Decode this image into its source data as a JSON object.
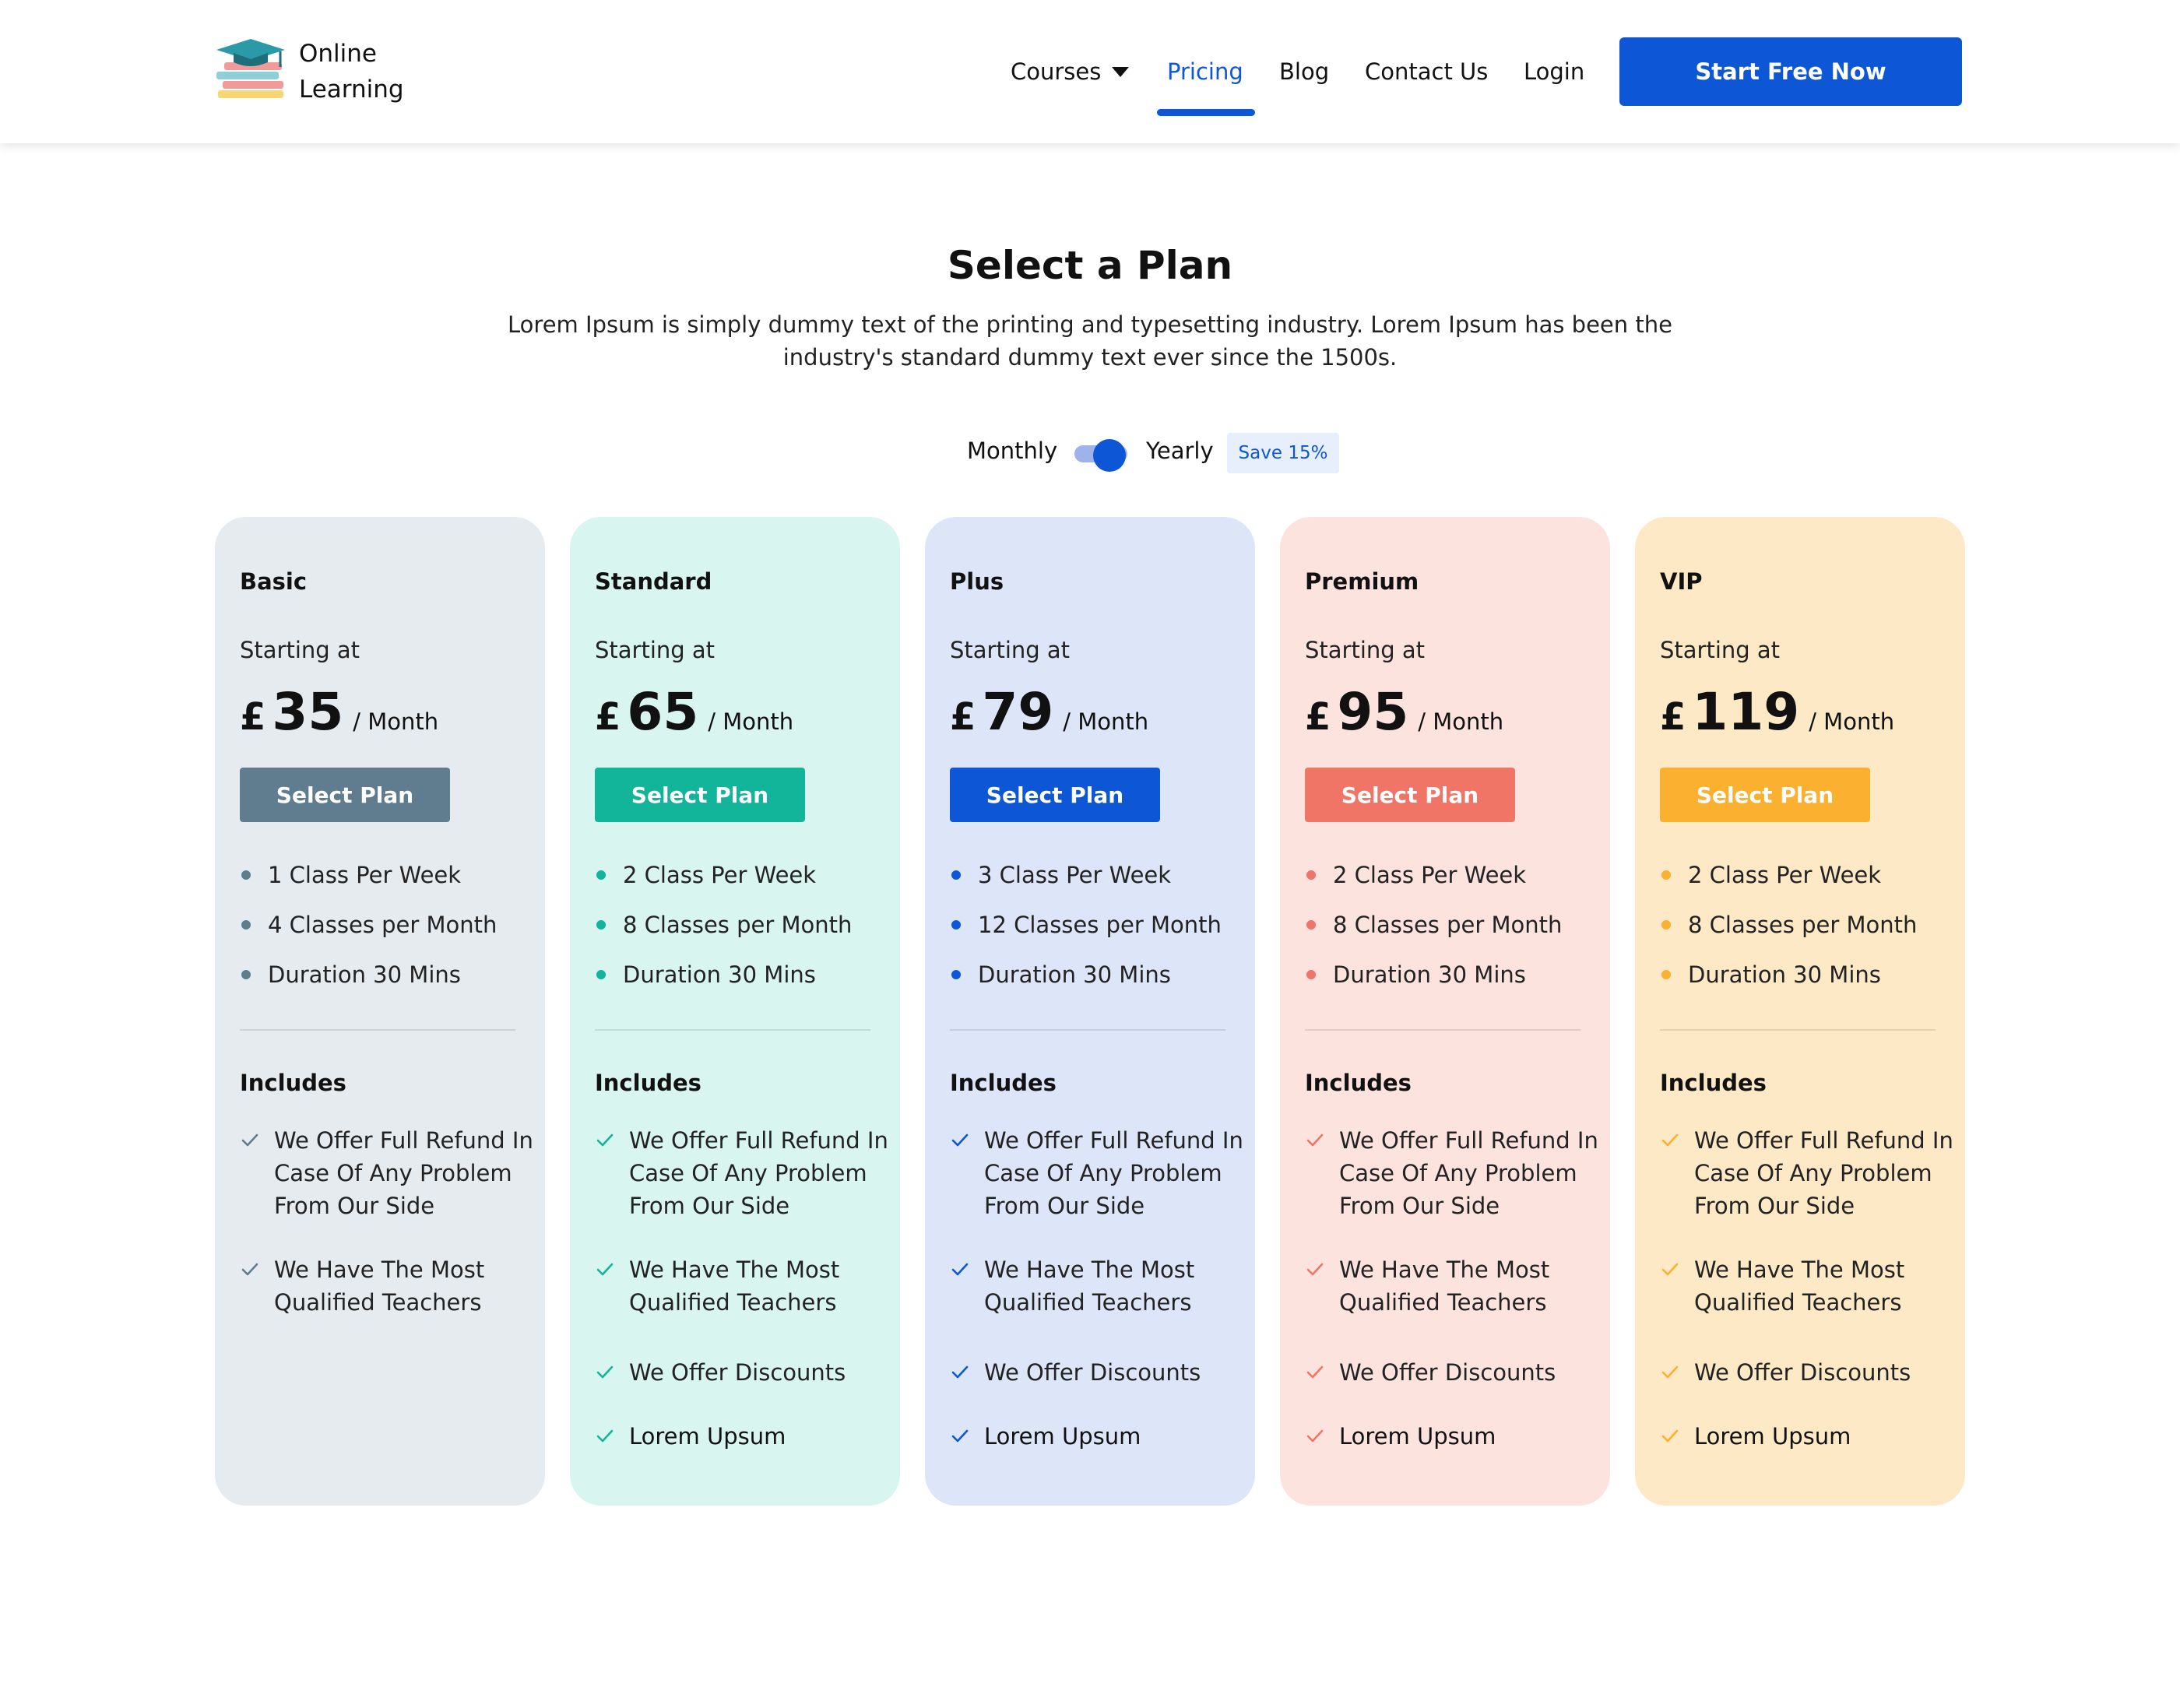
{
  "brand": {
    "line1": "Online",
    "line2": "Learning"
  },
  "nav": {
    "courses": "Courses",
    "pricing": "Pricing",
    "blog": "Blog",
    "contact": "Contact Us",
    "login": "Login",
    "cta": "Start Free Now"
  },
  "hero": {
    "title": "Select a Plan",
    "subtitle": "Lorem Ipsum is simply dummy text of the printing and typesetting industry. Lorem Ipsum has been the industry's standard dummy text ever since the 1500s."
  },
  "billing": {
    "monthly": "Monthly",
    "yearly": "Yearly",
    "selected": "Yearly",
    "save_badge": "Save 15%"
  },
  "colors": {
    "primary": "#0d57d6",
    "basic": "#5f7d8e",
    "standard": "#13b59a",
    "plus": "#0d57d6",
    "premium": "#f17566",
    "vip": "#fbb02f"
  },
  "plans": [
    {
      "name": "Basic",
      "starting": "Starting at",
      "currency": "£",
      "price": "35",
      "period": "/ Month",
      "button": "Select Plan",
      "features": [
        "1 Class Per Week",
        "4 Classes per Month",
        "Duration 30 Mins"
      ],
      "includes_title": "Includes",
      "includes": [
        "We Offer Full Refund In Case Of Any Problem From Our Side",
        "We Have The Most Qualified Teachers"
      ]
    },
    {
      "name": "Standard",
      "starting": "Starting at",
      "currency": "£",
      "price": "65",
      "period": "/ Month",
      "button": "Select Plan",
      "features": [
        "2 Class Per Week",
        "8 Classes per Month",
        "Duration 30 Mins"
      ],
      "includes_title": "Includes",
      "includes": [
        "We Offer Full Refund In Case Of Any Problem From Our Side",
        "We Have The Most Qualified Teachers",
        "We Offer Discounts",
        "Lorem Upsum"
      ]
    },
    {
      "name": "Plus",
      "starting": "Starting at",
      "currency": "£",
      "price": "79",
      "period": "/ Month",
      "button": "Select Plan",
      "features": [
        "3 Class Per Week",
        "12 Classes per Month",
        "Duration 30 Mins"
      ],
      "includes_title": "Includes",
      "includes": [
        "We Offer Full Refund In Case Of Any Problem From Our Side",
        "We Have The Most Qualified Teachers",
        "We Offer Discounts",
        "Lorem Upsum"
      ]
    },
    {
      "name": "Premium",
      "starting": "Starting at",
      "currency": "£",
      "price": "95",
      "period": "/ Month",
      "button": "Select Plan",
      "features": [
        "2 Class Per Week",
        "8 Classes per Month",
        "Duration 30 Mins"
      ],
      "includes_title": "Includes",
      "includes": [
        "We Offer Full Refund In Case Of Any Problem From Our Side",
        "We Have The Most Qualified Teachers",
        "We Offer Discounts",
        "Lorem Upsum"
      ]
    },
    {
      "name": "VIP",
      "starting": "Starting at",
      "currency": "£",
      "price": "119",
      "period": "/ Month",
      "button": "Select Plan",
      "features": [
        "2 Class Per Week",
        "8 Classes per Month",
        "Duration 30 Mins"
      ],
      "includes_title": "Includes",
      "includes": [
        "We Offer Full Refund In Case Of Any Problem From Our Side",
        "We Have The Most Qualified Teachers",
        "We Offer Discounts",
        "Lorem Upsum"
      ]
    }
  ]
}
